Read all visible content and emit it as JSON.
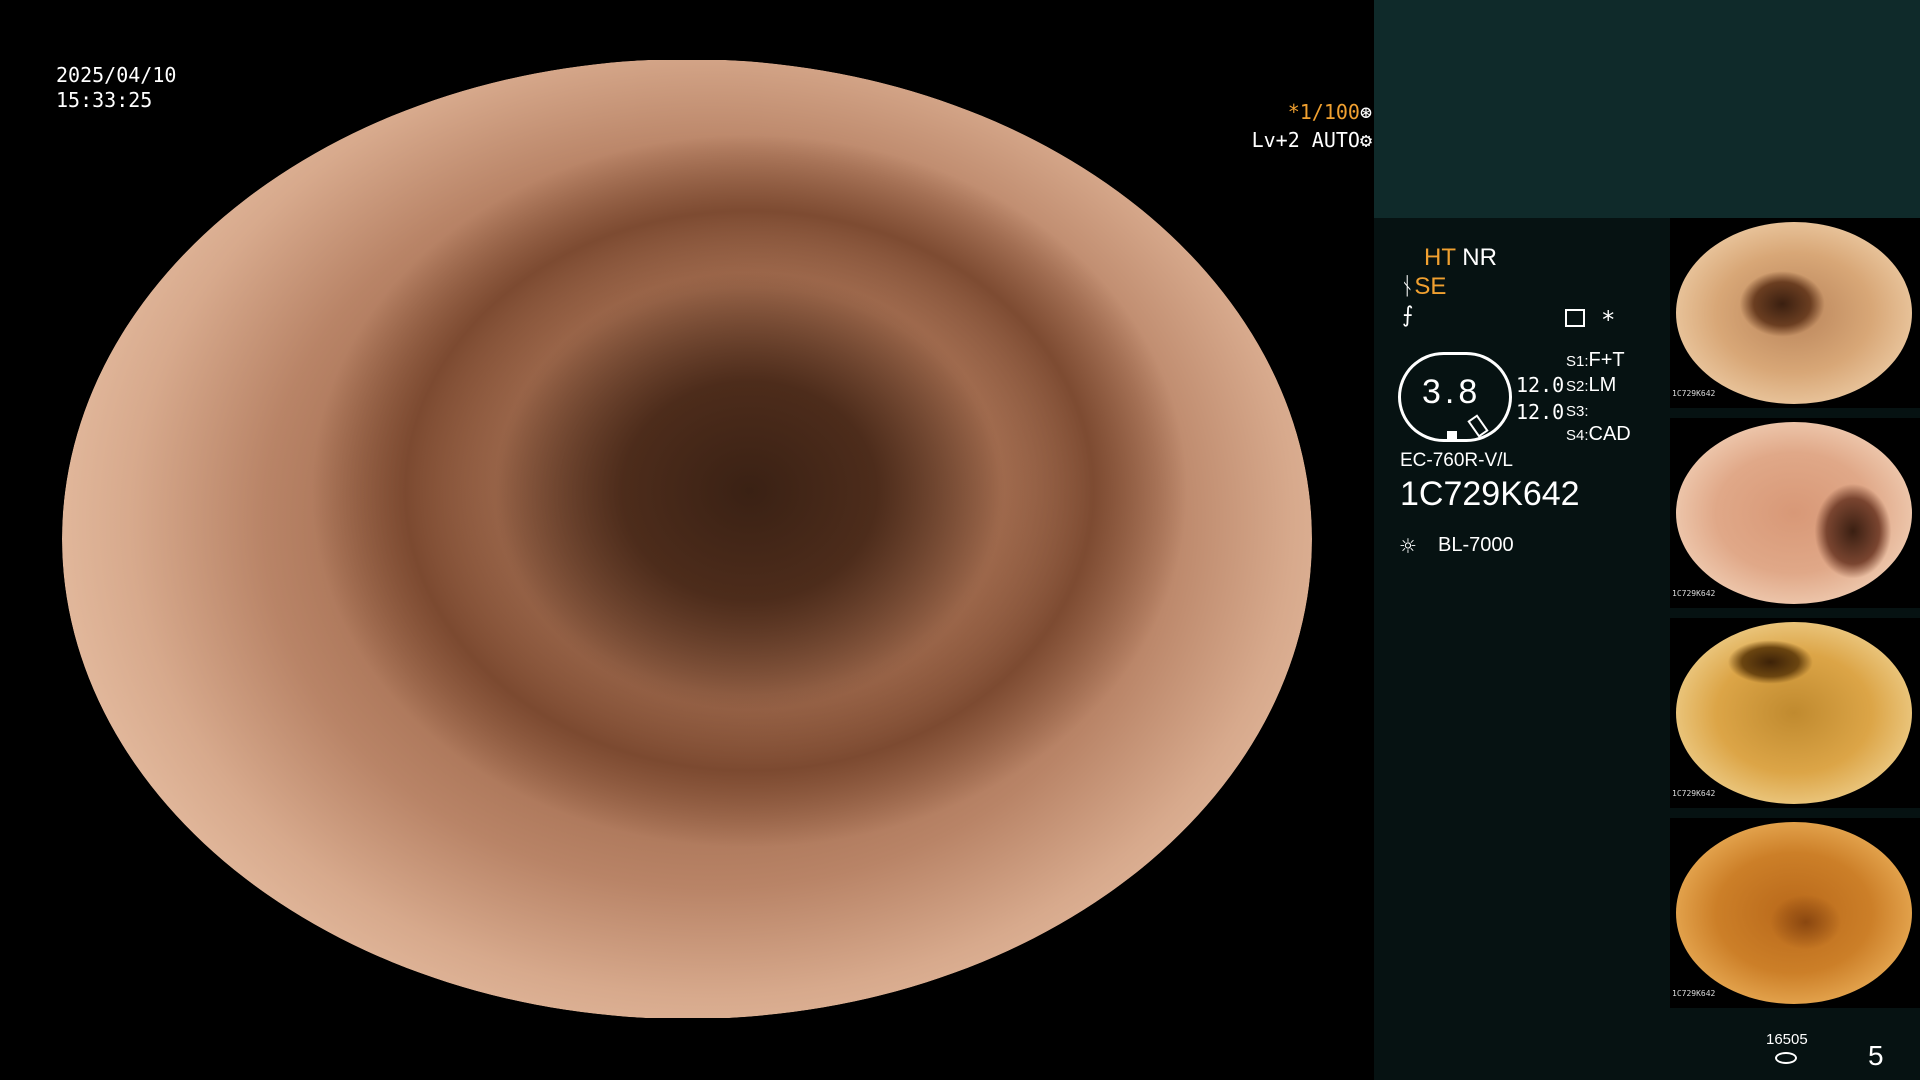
{
  "main": {
    "date": "2025/04/10",
    "time": "15:33:25",
    "shutter": "*1/100",
    "shutter_icon": "aperture-icon",
    "level": "Lv+2 AUTO",
    "level_icon": "gear-icon"
  },
  "panel": {
    "mode_ht": "HT",
    "mode_nr": "NR",
    "mode_se": "SE",
    "mode_f": "⨍",
    "star": "*",
    "zoom_value": "3.8",
    "gain_1": "12.0",
    "gain_2": "12.0",
    "switches": [
      {
        "key": "S1:",
        "value": "F+T"
      },
      {
        "key": "S2:",
        "value": "LM"
      },
      {
        "key": "S3:",
        "value": ""
      },
      {
        "key": "S4:",
        "value": "CAD"
      }
    ],
    "scope_model": "EC-760R-V/L",
    "scope_serial": "1C729K642",
    "light_source": "BL-7000",
    "light_icon": "sun-icon"
  },
  "thumbnails": [
    {
      "tag": "1C729K642"
    },
    {
      "tag": "1C729K642"
    },
    {
      "tag": "1C729K642"
    },
    {
      "tag": "1C729K642"
    }
  ],
  "footer": {
    "storage_count": "16505",
    "image_count": "5"
  },
  "colors": {
    "accent": "#f0a030",
    "panel_bg": "#061212",
    "panel_top_bg": "#0f2a2a"
  }
}
